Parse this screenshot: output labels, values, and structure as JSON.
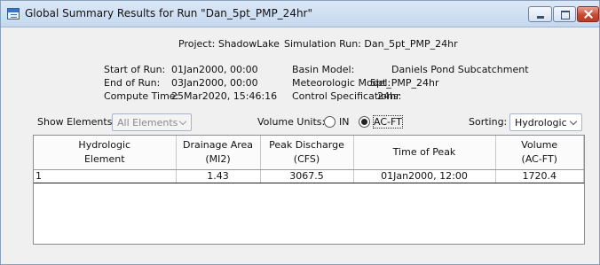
{
  "window": {
    "title": "Global Summary Results for Run \"Dan_5pt_PMP_24hr\""
  },
  "header": {
    "project": "Project: ShadowLake",
    "simulation_run": "Simulation Run: Dan_5pt_PMP_24hr"
  },
  "run_info": {
    "start_label": "Start of Run:",
    "start_value": "01Jan2000, 00:00",
    "end_label": "End of Run:",
    "end_value": "03Jan2000, 00:00",
    "compute_label": "Compute Time:",
    "compute_value": "25Mar2020, 15:46:16"
  },
  "model_info": {
    "basin_label": "Basin Model:",
    "basin_value": "Daniels Pond Subcatchment",
    "met_label": "Meteorologic Model:",
    "met_value": "5pt_PMP_24hr",
    "control_label": "Control Specifications:",
    "control_value": "24hr"
  },
  "controls": {
    "show_label": "Show Elements:",
    "show_value": "All Elements",
    "volume_label": "Volume Units:",
    "unit_in": "IN",
    "unit_acft": "AC-FT",
    "selected_unit": "AC-FT",
    "sorting_label": "Sorting:",
    "sorting_value": "Hydrologic"
  },
  "table": {
    "headers": [
      [
        "Hydrologic",
        "Element"
      ],
      [
        "Drainage Area",
        "(MI2)"
      ],
      [
        "Peak Discharge",
        "(CFS)"
      ],
      [
        "Time of Peak",
        ""
      ],
      [
        "Volume",
        "(AC-FT)"
      ]
    ],
    "rows": [
      [
        "1",
        "1.43",
        "3067.5",
        "01Jan2000, 12:00",
        "1720.4"
      ]
    ]
  }
}
